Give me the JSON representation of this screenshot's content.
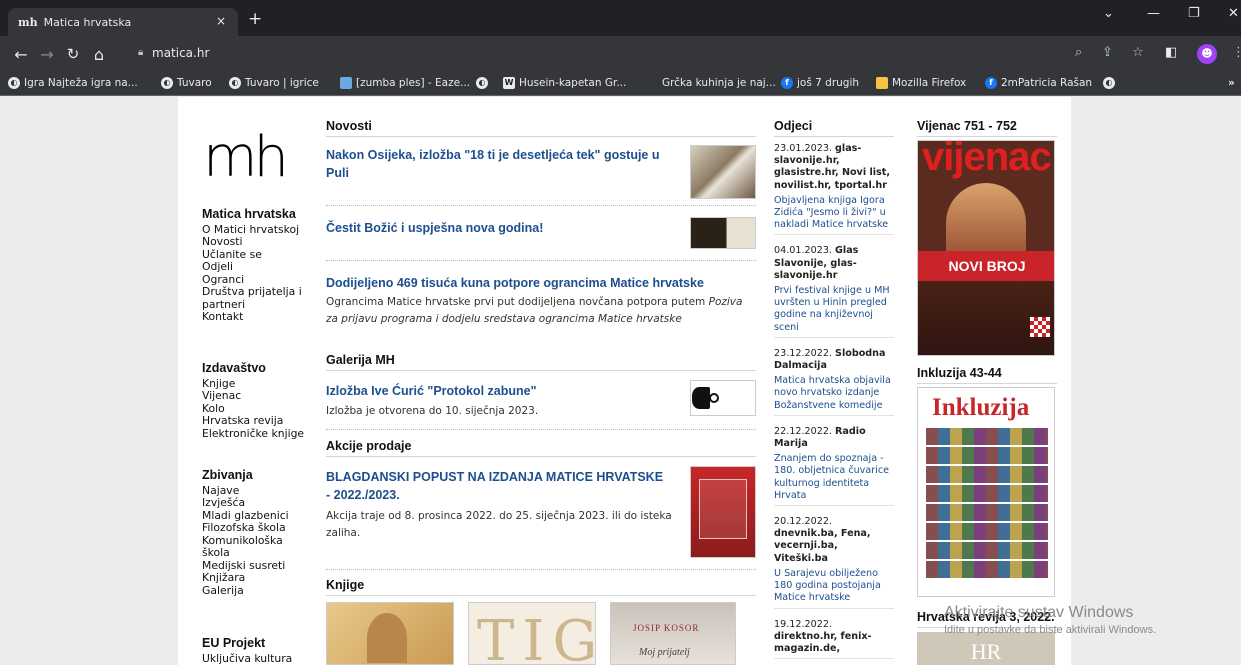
{
  "browser": {
    "tab_title": "Matica hrvatska",
    "tab_favicon": "mh",
    "tab_close": "×",
    "new_tab": "+",
    "url": "matica.hr",
    "bookmarks": [
      {
        "icon": "page-icon",
        "label": "Igra Najteža igra na..."
      },
      {
        "icon": "globe-icon",
        "label": "Tuvaro"
      },
      {
        "icon": "globe-icon",
        "label": "Tuvaro | igrice"
      },
      {
        "icon": "image-icon",
        "label": "[zumba ples] - Eaze..."
      },
      {
        "icon": "globe-icon",
        "label": ""
      },
      {
        "icon": "w-icon",
        "label": "Husein-kapetan Gr..."
      },
      {
        "icon": "none",
        "label": "Grčka kuhinja je naj..."
      },
      {
        "icon": "facebook-icon",
        "label": "još 7 drugih"
      },
      {
        "icon": "folder-icon",
        "label": "Mozilla Firefox"
      },
      {
        "icon": "facebook-icon",
        "label": "2mPatricia Rašan"
      },
      {
        "icon": "globe-icon",
        "label": ""
      }
    ],
    "bookmarks_overflow": "»"
  },
  "sidebar": {
    "logo": "mh",
    "sections": [
      {
        "title": "Matica hrvatska",
        "items": [
          "O Matici hrvatskoj",
          "Novosti",
          "Učlanite se",
          "Odjeli",
          "Ogranci",
          "Društva prijatelja i partneri",
          "Kontakt"
        ]
      },
      {
        "title": "Izdavaštvo",
        "items": [
          "Knjige",
          "Vijenac",
          "Kolo",
          "Hrvatska revija",
          "Elektroničke knjige"
        ]
      },
      {
        "title": "Zbivanja",
        "items": [
          "Najave",
          "Izvješća",
          "Mladi glazbenici",
          "Filozofska škola",
          "Komunikološka škola",
          "Medijski susreti",
          "Knjižara",
          "Galerija"
        ]
      },
      {
        "title": "EU Projekt",
        "items": [
          "Uključiva kultura"
        ]
      }
    ]
  },
  "main": {
    "novosti_heading": "Novosti",
    "news": [
      {
        "title": "Nakon Osijeka, izložba \"18 ti je desetljeća tek\" gostuje u Puli",
        "desc": ""
      },
      {
        "title": "Čestit Božić i uspješna nova godina!",
        "desc": ""
      },
      {
        "title": "Dodijeljeno 469 tisuća kuna potpore ograncima Matice hrvatske",
        "desc": "Ograncima Matice hrvatske prvi put dodijeljena novčana potpora putem",
        "desc_italic": "Poziva za prijavu programa i dodjelu sredstava ograncima Matice hrvatske"
      }
    ],
    "galerija_heading": "Galerija MH",
    "galerija": {
      "title": "Izložba Ive Ćurić \"Protokol zabune\"",
      "desc": "Izložba je otvorena do 10. siječnja 2023."
    },
    "akcije_heading": "Akcije prodaje",
    "akcije": {
      "title": "BLAGDANSKI POPUST NA IZDANJA MATICE HRVATSKE - 2022./2023.",
      "desc": "Akcija traje od 8. prosinca 2022. do 25. siječnja 2023. ili do isteka zaliha."
    },
    "knjige_heading": "Knjige",
    "book_texts": [
      "JOSIP KOSOR",
      "Moj prijatelj"
    ]
  },
  "odjeci": {
    "heading": "Odjeci",
    "items": [
      {
        "date": "23.01.2023.",
        "sources": "glas-slavonije.hr, glasistre.hr, Novi list, novilist.hr, tportal.hr",
        "link": "Objavljena knjiga Igora Zidića \"Jesmo li živi?\" u nakladi Matice hrvatske"
      },
      {
        "date": "04.01.2023.",
        "sources": "Glas Slavonije, glas-slavonije.hr",
        "link": "Prvi festival knjige u MH uvršten u Hinin pregled godine na književnoj sceni"
      },
      {
        "date": "23.12.2022.",
        "sources": "Slobodna Dalmacija",
        "link": "Matica hrvatska objavila novo hrvatsko izdanje Božanstvene komedije"
      },
      {
        "date": "22.12.2022.",
        "sources": "Radio Marija",
        "link": "Znanjem do spoznaja - 180. obljetnica čuvarice kulturnog identiteta Hrvata"
      },
      {
        "date": "20.12.2022.",
        "sources": "dnevnik.ba, Fena, vecernji.ba, Viteški.ba",
        "link": "U Sarajevu obilježeno 180 godina postojanja Matice hrvatske"
      },
      {
        "date": "19.12.2022.",
        "sources": "direktno.hr, fenix-magazin.de,",
        "link": ""
      }
    ]
  },
  "right": {
    "vijenac_heading": "Vijenac 751 - 752",
    "vijenac_cover_title": "vijenac",
    "vijenac_banner": "NOVI BROJ",
    "inkluzija_heading": "Inkluzija 43-44",
    "inkluzija_cover_title": "Inkluzija",
    "revija_heading": "Hrvatska revija 3, 2022.",
    "revija_cover_text": "HR"
  },
  "watermark": {
    "line1": "Aktivirajte sustav Windows",
    "line2": "Idite u postavke da biste aktivirali Windows."
  }
}
